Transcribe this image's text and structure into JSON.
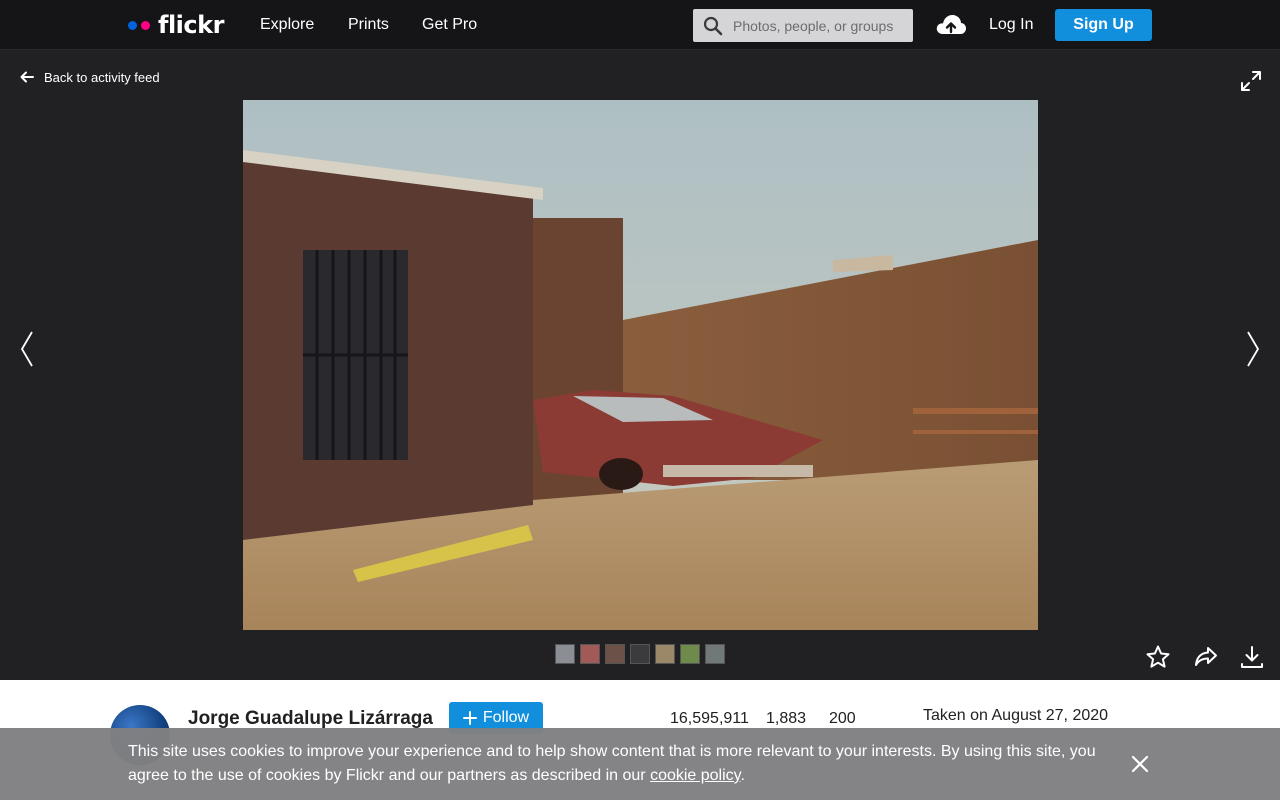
{
  "topnav": {
    "logo_text": "flickr",
    "links": [
      "Explore",
      "Prints",
      "Get Pro"
    ],
    "search_placeholder": "Photos, people, or groups",
    "login": "Log In",
    "signup": "Sign Up"
  },
  "viewer": {
    "back_label": "Back to activity feed",
    "thumb_colors": [
      "#8b8f95",
      "#a25a58",
      "#6c5148",
      "#3b3a3c",
      "#9a8868",
      "#6f8b4b",
      "#707878"
    ]
  },
  "info": {
    "owner_name": "Jorge Guadalupe Lizárraga",
    "follow_label": "Follow",
    "stats": [
      "16,595,911",
      "1,883",
      "200"
    ],
    "taken": "Taken on August 27, 2020"
  },
  "cookie": {
    "text": "This site uses cookies to improve your experience and to help show content that is more relevant to your interests. By using this site, you agree to the use of cookies by Flickr and our partners as described in our ",
    "link_text": "cookie policy",
    "text_end": "."
  },
  "colors": {
    "accent": "#128fdc",
    "logo_blue": "#0063dc",
    "logo_pink": "#ff0084"
  }
}
